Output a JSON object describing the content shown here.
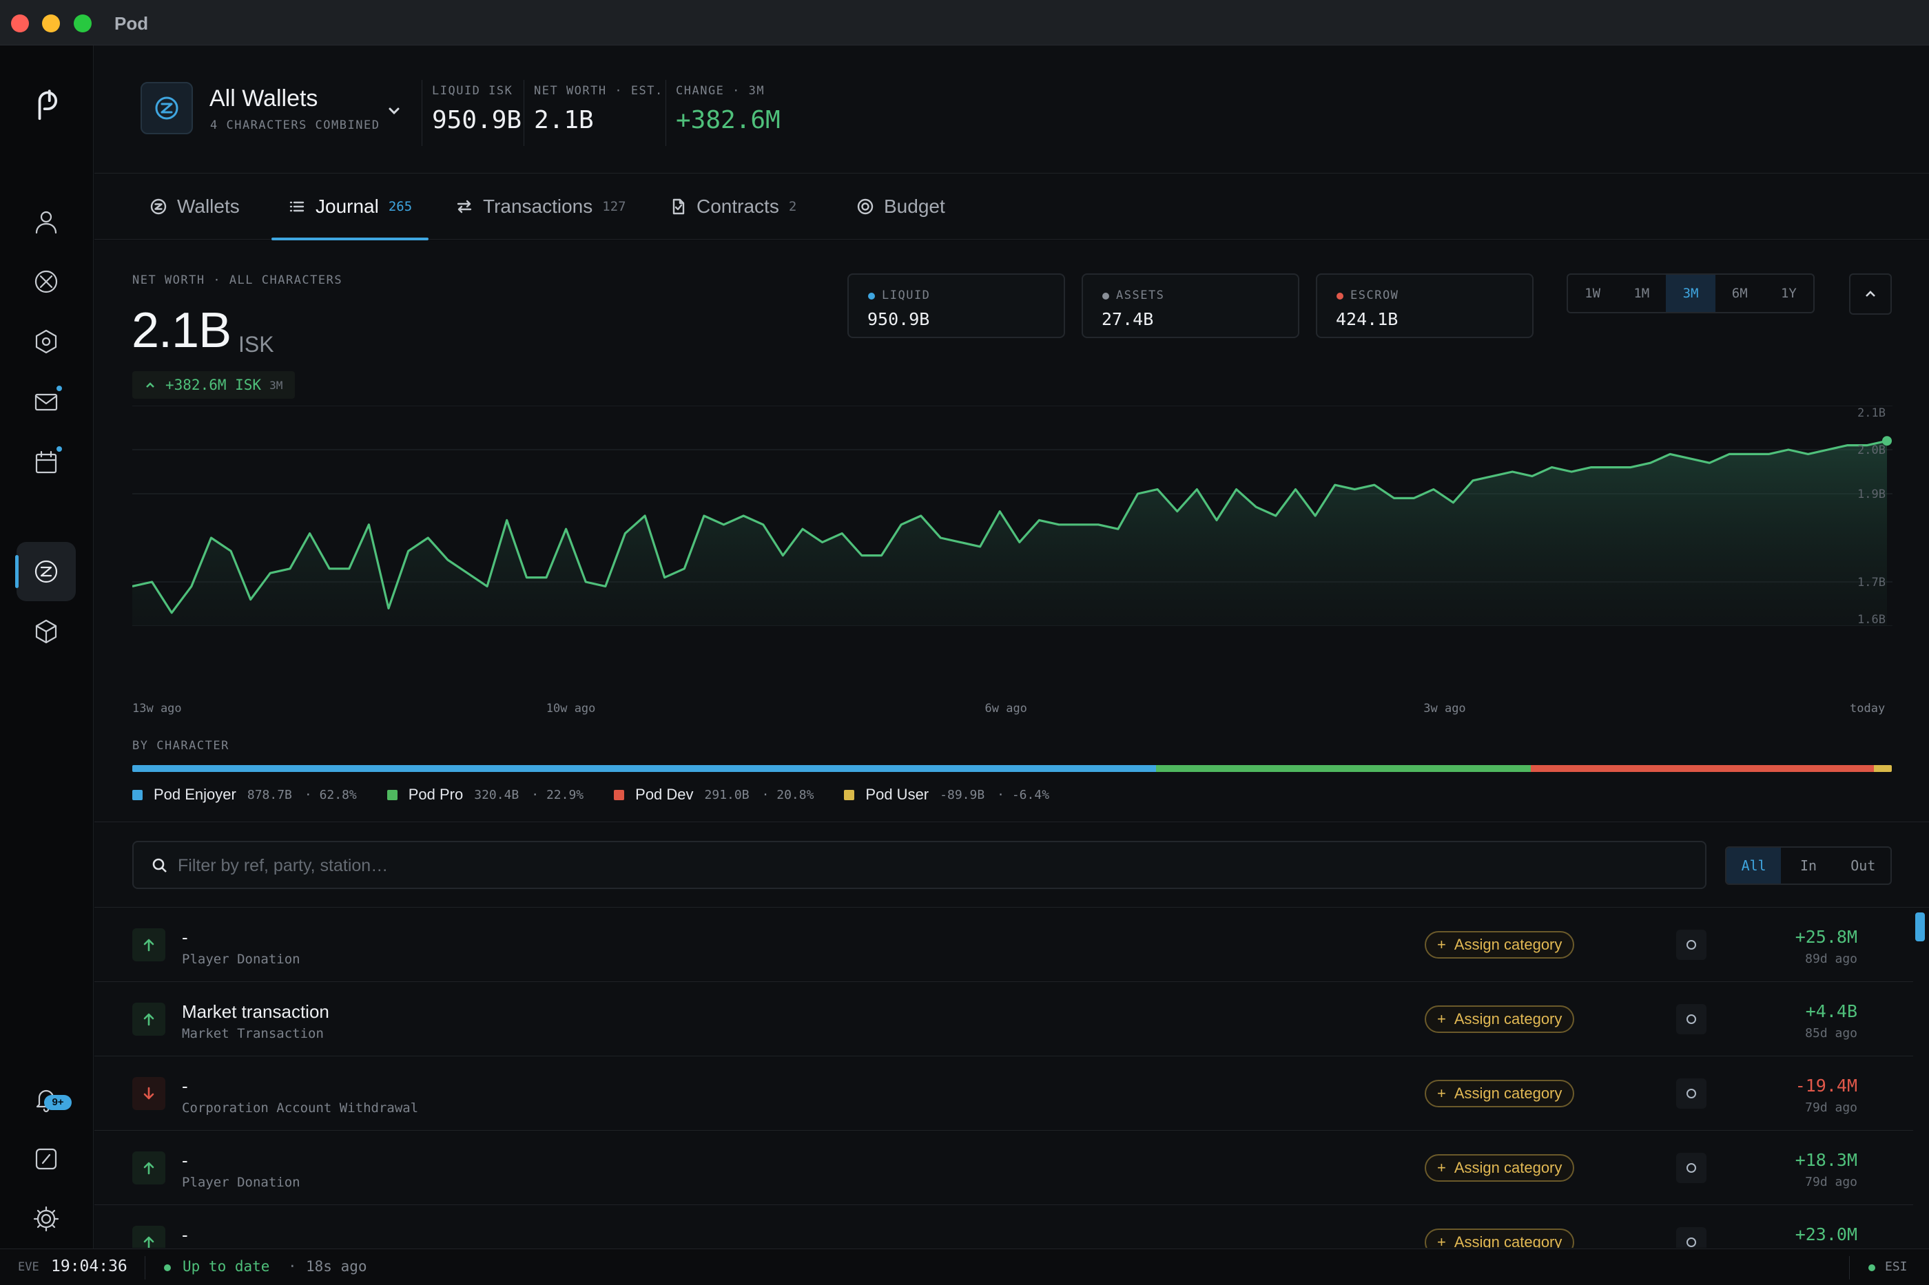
{
  "window": {
    "title": "Pod",
    "traffic_lights": {
      "close": "#ff5f57",
      "minimize": "#febc2e",
      "zoom": "#28c840"
    }
  },
  "rail": {
    "logo": "pod-logo-icon",
    "items": [
      {
        "icon": "character-icon",
        "dot": false
      },
      {
        "icon": "corporation-icon",
        "dot": false
      },
      {
        "icon": "skills-icon",
        "dot": false
      },
      {
        "icon": "mail-icon",
        "dot": true
      },
      {
        "icon": "calendar-icon",
        "dot": true
      },
      {
        "icon": "wallet-icon",
        "active": true
      },
      {
        "icon": "assets-icon"
      }
    ],
    "bottom": [
      {
        "icon": "bell-icon",
        "badge": "9+"
      },
      {
        "icon": "dashboard-icon"
      },
      {
        "icon": "gear-icon"
      }
    ]
  },
  "header": {
    "wallet_name": "All Wallets",
    "wallet_sub": "4 CHARACTERS COMBINED",
    "stats": [
      {
        "label": "LIQUID ISK",
        "value": "950.9B"
      },
      {
        "label": "NET WORTH · EST.",
        "value": "2.1B"
      },
      {
        "label": "CHANGE · 3M",
        "value": "+382.6M"
      }
    ]
  },
  "tabs": [
    {
      "label": "Wallets",
      "count": "",
      "icon": "wallet-icon"
    },
    {
      "label": "Journal",
      "count": "265",
      "icon": "list-icon",
      "active": true
    },
    {
      "label": "Transactions",
      "count": "127",
      "icon": "transfer-icon"
    },
    {
      "label": "Contracts",
      "count": "2",
      "icon": "document-icon"
    },
    {
      "label": "Budget",
      "count": "",
      "icon": "target-icon"
    }
  ],
  "overview": {
    "label": "NET WORTH · ALL CHARACTERS",
    "value": "2.1B",
    "unit": "ISK",
    "change": "+382.6M ISK",
    "change_period": "3M",
    "cards": [
      {
        "label": "LIQUID",
        "value": "950.9B",
        "color": "#3fa6e0"
      },
      {
        "label": "ASSETS",
        "value": "27.4B",
        "color": "#8a9098"
      },
      {
        "label": "ESCROW",
        "value": "424.1B",
        "color": "#e0584a"
      }
    ],
    "ranges": [
      "1W",
      "1M",
      "3M",
      "6M",
      "1Y"
    ],
    "active_range": "3M"
  },
  "chart_data": {
    "type": "area",
    "y_unit": "ISK (billions)",
    "ylim": [
      1.6,
      2.1
    ],
    "yticks": [
      {
        "v": 2.1,
        "label": "2.1B"
      },
      {
        "v": 2.0,
        "label": "2.0B"
      },
      {
        "v": 1.9,
        "label": "1.9B"
      },
      {
        "v": 1.7,
        "label": "1.7B"
      },
      {
        "v": 1.6,
        "label": "1.6B"
      }
    ],
    "xticks": [
      "13w ago",
      "10w ago",
      "6w ago",
      "3w ago",
      "today"
    ],
    "grid": true,
    "series": [
      {
        "color": "#4fc07b",
        "values": [
          1.69,
          1.7,
          1.63,
          1.69,
          1.8,
          1.77,
          1.66,
          1.72,
          1.73,
          1.81,
          1.73,
          1.73,
          1.83,
          1.64,
          1.77,
          1.8,
          1.75,
          1.72,
          1.69,
          1.84,
          1.71,
          1.71,
          1.82,
          1.7,
          1.69,
          1.81,
          1.85,
          1.71,
          1.73,
          1.85,
          1.83,
          1.85,
          1.83,
          1.76,
          1.82,
          1.79,
          1.81,
          1.76,
          1.76,
          1.83,
          1.85,
          1.8,
          1.79,
          1.78,
          1.86,
          1.79,
          1.84,
          1.83,
          1.83,
          1.83,
          1.82,
          1.9,
          1.91,
          1.86,
          1.91,
          1.84,
          1.91,
          1.87,
          1.85,
          1.91,
          1.85,
          1.92,
          1.91,
          1.92,
          1.89,
          1.89,
          1.91,
          1.88,
          1.93,
          1.94,
          1.95,
          1.94,
          1.96,
          1.95,
          1.96,
          1.96,
          1.96,
          1.97,
          1.99,
          1.98,
          1.97,
          1.99,
          1.99,
          1.99,
          2.0,
          1.99,
          2.0,
          2.01,
          2.01,
          2.02
        ]
      }
    ]
  },
  "by_character": {
    "label": "BY CHARACTER",
    "items": [
      {
        "name": "Pod Enjoyer",
        "value": "878.7B",
        "percent": "62.8%",
        "share": 58.2,
        "color": "#3fa6e0"
      },
      {
        "name": "Pod Pro",
        "value": "320.4B",
        "percent": "22.9%",
        "share": 21.3,
        "color": "#4fb85f"
      },
      {
        "name": "Pod Dev",
        "value": "291.0B",
        "percent": "20.8%",
        "share": 19.5,
        "color": "#df5745"
      },
      {
        "name": "Pod User",
        "value": "-89.9B",
        "percent": "-6.4%",
        "share": 1.0,
        "color": "#d9b949"
      }
    ]
  },
  "filter": {
    "placeholder": "Filter by ref, party, station…",
    "value": "",
    "options": [
      "All",
      "In",
      "Out"
    ],
    "active": "All"
  },
  "journal": [
    {
      "title": "-",
      "type": "Player Donation",
      "direction": "in",
      "assign": "Assign category",
      "amount": "+25.8M",
      "age": "89d ago"
    },
    {
      "title": "Market transaction",
      "type": "Market Transaction",
      "direction": "in",
      "assign": "Assign category",
      "amount": "+4.4B",
      "age": "85d ago"
    },
    {
      "title": "-",
      "type": "Corporation Account Withdrawal",
      "direction": "out",
      "assign": "Assign category",
      "amount": "-19.4M",
      "age": "79d ago"
    },
    {
      "title": "-",
      "type": "Player Donation",
      "direction": "in",
      "assign": "Assign category",
      "amount": "+18.3M",
      "age": "79d ago"
    },
    {
      "title": "-",
      "type": "",
      "direction": "in",
      "assign": "Assign category",
      "amount": "+23.0M",
      "age": ""
    }
  ],
  "status_bar": {
    "eve_label": "EVE",
    "time": "19:04:36",
    "status": "Up to date",
    "separator": "·",
    "ago": "18s ago",
    "esi": "ESI"
  }
}
